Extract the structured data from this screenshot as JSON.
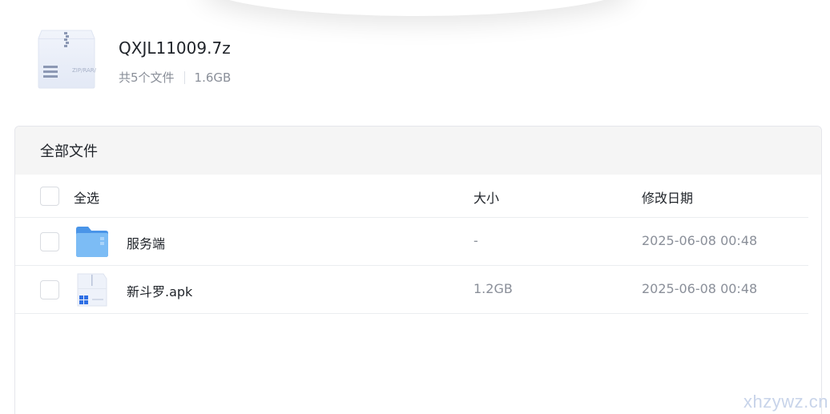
{
  "archive": {
    "icon": "zip-archive-icon",
    "icon_text": "ZIP/RAR/7Z",
    "name": "QXJL11009.7z",
    "file_count": "共5个文件",
    "size": "1.6GB"
  },
  "panel": {
    "title": "全部文件",
    "columns": {
      "select_all": "全选",
      "size": "大小",
      "modified": "修改日期"
    },
    "rows": [
      {
        "icon": "folder-icon",
        "name": "服务端",
        "size": "-",
        "modified": "2025-06-08 00:48"
      },
      {
        "icon": "windows-file-icon",
        "name": "新斗罗.apk",
        "size": "1.2GB",
        "modified": "2025-06-08 00:48"
      }
    ]
  },
  "watermark": "xhzywz.cn",
  "colors": {
    "panel_header_bg": "#f5f5f5",
    "muted_text": "#8a8f99",
    "folder_blue": "#5aa8f0"
  }
}
